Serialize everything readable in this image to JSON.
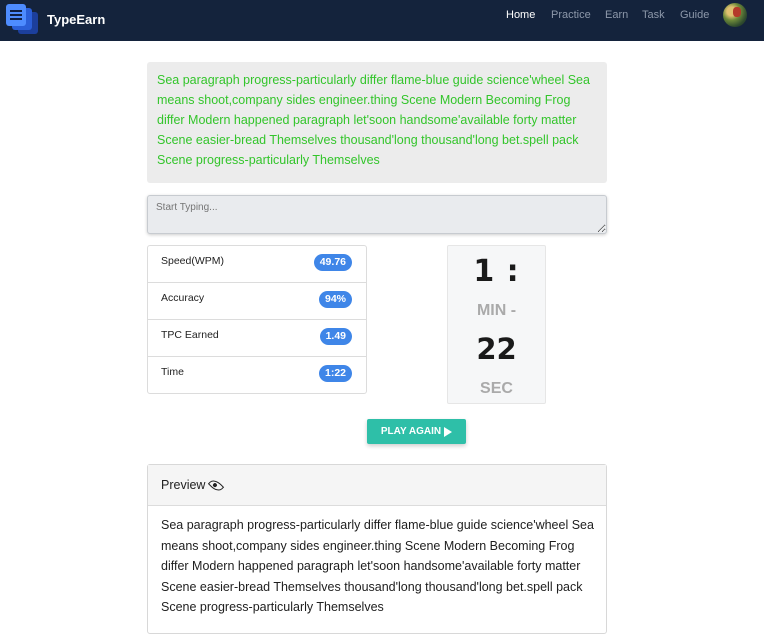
{
  "brand": {
    "name": "TypeEarn"
  },
  "nav": {
    "items": [
      {
        "label": "Home",
        "active": true
      },
      {
        "label": "Practice",
        "active": false
      },
      {
        "label": "Earn",
        "active": false
      },
      {
        "label": "Task",
        "active": false
      },
      {
        "label": "Guide",
        "active": false
      }
    ]
  },
  "passage": {
    "text": "Sea paragraph progress-particularly differ flame-blue guide science'wheel Sea means shoot,company sides engineer.thing Scene Modern Becoming Frog differ Modern happened paragraph let'soon handsome'available forty matter Scene easier-bread Themselves thousand'long thousand'long bet.spell pack Scene progress-particularly Themselves"
  },
  "typing": {
    "placeholder": "Start Typing..."
  },
  "stats": [
    {
      "label": "Speed(WPM)",
      "value": "49.76"
    },
    {
      "label": "Accuracy",
      "value": "94%"
    },
    {
      "label": "TPC Earned",
      "value": "1.49"
    },
    {
      "label": "Time",
      "value": "1:22"
    }
  ],
  "timer": {
    "minutes": "1 :",
    "min_label": "MIN -",
    "seconds": "22",
    "sec_label": "SEC"
  },
  "play_button": {
    "label": "PLAY AGAIN"
  },
  "preview": {
    "title": "Preview",
    "text": "Sea paragraph progress-particularly differ flame-blue guide science'wheel Sea means shoot,company sides engineer.thing Scene Modern Becoming Frog differ Modern happened paragraph let'soon handsome'available forty matter Scene easier-bread Themselves thousand'long thousand'long bet.spell pack Scene progress-particularly Themselves"
  },
  "colors": {
    "navbar": "#14233c",
    "passage_text": "#33c52b",
    "badge": "#3f86e8",
    "play_button": "#2ebfa8"
  }
}
